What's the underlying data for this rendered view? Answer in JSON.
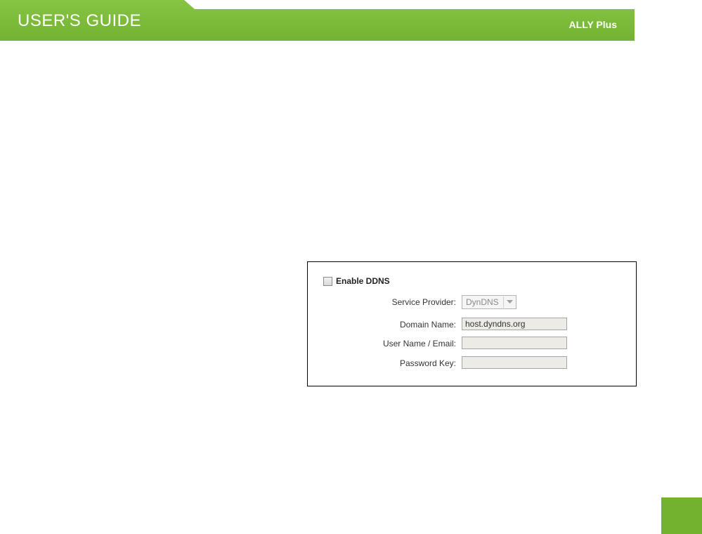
{
  "header": {
    "title": "USER'S GUIDE",
    "product": "ALLY Plus"
  },
  "colors": {
    "brand_green": "#7cbd3a",
    "corner_green": "#73b22f"
  },
  "ddns": {
    "enable_label": "Enable DDNS",
    "enable_checked": false,
    "fields": {
      "service_provider_label": "Service Provider:",
      "service_provider_value": "DynDNS",
      "domain_name_label": "Domain Name:",
      "domain_name_value": "host.dyndns.org",
      "username_label": "User Name / Email:",
      "username_value": "",
      "password_label": "Password Key:",
      "password_value": ""
    }
  }
}
